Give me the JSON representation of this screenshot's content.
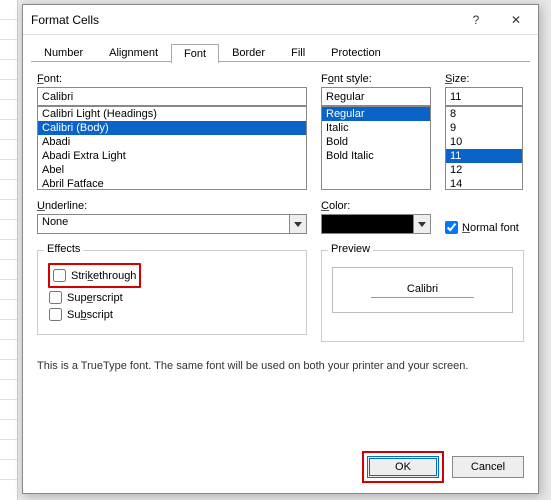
{
  "titlebar": {
    "title": "Format Cells",
    "help": "?",
    "close": "✕"
  },
  "tabs": [
    "Number",
    "Alignment",
    "Font",
    "Border",
    "Fill",
    "Protection"
  ],
  "active_tab": "Font",
  "font": {
    "label": "Font:",
    "value": "Calibri",
    "options": [
      "Calibri Light (Headings)",
      "Calibri (Body)",
      "Abadi",
      "Abadi Extra Light",
      "Abel",
      "Abril Fatface"
    ],
    "selected": "Calibri (Body)"
  },
  "fontstyle": {
    "label": "Font style:",
    "value": "Regular",
    "options": [
      "Regular",
      "Italic",
      "Bold",
      "Bold Italic"
    ],
    "selected": "Regular"
  },
  "size": {
    "label": "Size:",
    "value": "11",
    "options": [
      "8",
      "9",
      "10",
      "11",
      "12",
      "14"
    ],
    "selected": "11"
  },
  "underline": {
    "label": "Underline:",
    "value": "None"
  },
  "color": {
    "label": "Color:"
  },
  "normal_font": {
    "label": "Normal font",
    "checked": true
  },
  "effects": {
    "title": "Effects",
    "strike": "Strikethrough",
    "superscript": "Superscript",
    "subscript": "Subscript"
  },
  "preview": {
    "title": "Preview",
    "sample": "Calibri"
  },
  "description": "This is a TrueType font.  The same font will be used on both your printer and your screen.",
  "buttons": {
    "ok": "OK",
    "cancel": "Cancel"
  }
}
